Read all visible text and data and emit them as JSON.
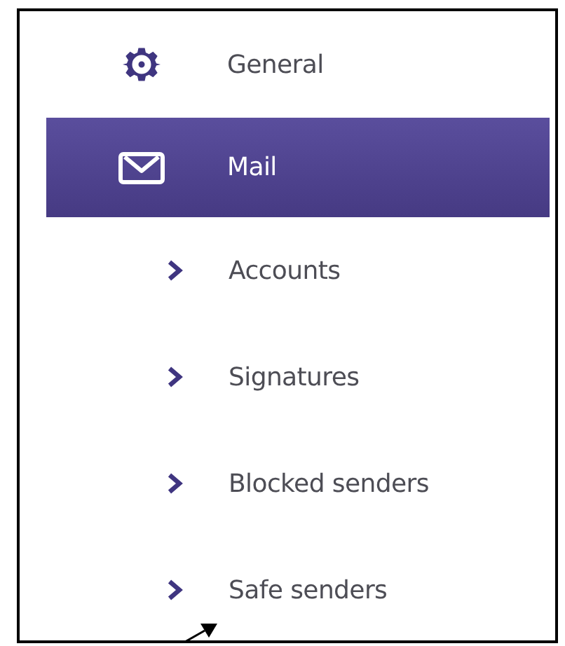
{
  "settings_menu": {
    "items": [
      {
        "label": "General",
        "selected": false
      },
      {
        "label": "Mail",
        "selected": true,
        "children": [
          {
            "label": "Accounts",
            "selected": false
          },
          {
            "label": "Signatures",
            "selected": false
          },
          {
            "label": "Blocked senders",
            "selected": false
          },
          {
            "label": "Safe senders",
            "selected": false
          }
        ]
      }
    ]
  }
}
